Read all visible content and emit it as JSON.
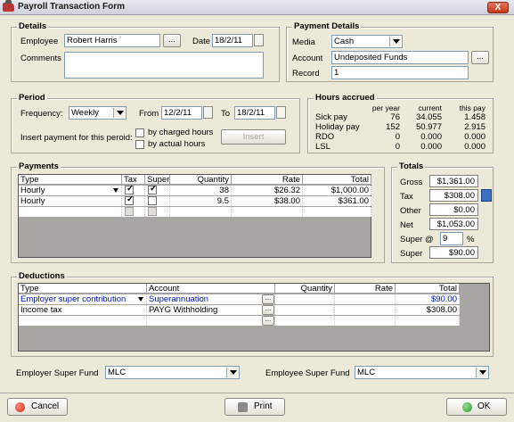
{
  "window": {
    "title": "Payroll Transaction Form",
    "close_label": "X"
  },
  "details": {
    "title": "Details",
    "employee_label": "Employee",
    "employee_value": "Robert Harris",
    "browse_label": "...",
    "date_label": "Date",
    "date_value": "18/2/11",
    "comments_label": "Comments",
    "comments_value": ""
  },
  "payment_details": {
    "title": "Payment Details",
    "media_label": "Media",
    "media_value": "Cash",
    "account_label": "Account",
    "account_value": "Undeposited Funds",
    "browse_label": "...",
    "record_label": "Record",
    "record_value": "1"
  },
  "period": {
    "title": "Period",
    "frequency_label": "Frequency:",
    "frequency_value": "Weekly",
    "from_label": "From",
    "from_value": "12/2/11",
    "to_label": "To",
    "to_value": "18/2/11",
    "insert_label": "Insert payment for this peroid:",
    "by_charged_hours": "by charged hours",
    "by_actual_hours": "by actual hours",
    "insert_button": "Insert"
  },
  "hours_accrued": {
    "title": "Hours accrued",
    "columns": [
      "per year",
      "current",
      "this pay"
    ],
    "rows": [
      {
        "label": "Sick pay",
        "values": [
          "76",
          "34.055",
          "1.458"
        ]
      },
      {
        "label": "Holiday pay",
        "values": [
          "152",
          "50.977",
          "2.915"
        ]
      },
      {
        "label": "RDO",
        "values": [
          "0",
          "0.000",
          "0.000"
        ]
      },
      {
        "label": "LSL",
        "values": [
          "0",
          "0.000",
          "0.000"
        ]
      }
    ]
  },
  "payments": {
    "title": "Payments",
    "columns": [
      "Type",
      "Tax",
      "Super",
      "Quantity",
      "Rate",
      "Total"
    ],
    "rows": [
      {
        "type": "Hourly",
        "tax": true,
        "super": true,
        "quantity": "38",
        "rate": "$26.32",
        "total": "$1,000.00"
      },
      {
        "type": "Hourly",
        "tax": true,
        "super": false,
        "quantity": "9.5",
        "rate": "$38.00",
        "total": "$361.00"
      }
    ]
  },
  "totals": {
    "title": "Totals",
    "gross_label": "Gross",
    "gross_value": "$1,361.00",
    "tax_label": "Tax",
    "tax_value": "$308.00",
    "other_label": "Other",
    "other_value": "$0.00",
    "net_label": "Net",
    "net_value": "$1,053.00",
    "super_at_label": "Super @",
    "super_rate": "9",
    "percent": "%",
    "super_label": "Super",
    "super_value": "$90.00"
  },
  "deductions": {
    "title": "Deductions",
    "columns": [
      "Type",
      "Account",
      "Quantity",
      "Rate",
      "Total"
    ],
    "rows": [
      {
        "type": "Employer super contribution",
        "account": "Superannuation",
        "total": "$90.00",
        "highlight": true
      },
      {
        "type": "Income tax",
        "account": "PAYG Withholding",
        "total": "$308.00",
        "highlight": false
      }
    ],
    "browse_label": "..."
  },
  "super_funds": {
    "employer_label": "Employer Super Fund",
    "employer_value": "MLC",
    "employee_label": "Employee Super Fund",
    "employee_value": "MLC"
  },
  "footer": {
    "cancel_label": "Cancel",
    "print_label": "Print",
    "ok_label": "OK"
  },
  "colors": {
    "window_bg": "#ece9d8",
    "grid_bg": "#a7a6a2",
    "link_blue": "#0010c0",
    "cancel_red": "#d42a1a",
    "ok_green": "#2f9a2f"
  }
}
